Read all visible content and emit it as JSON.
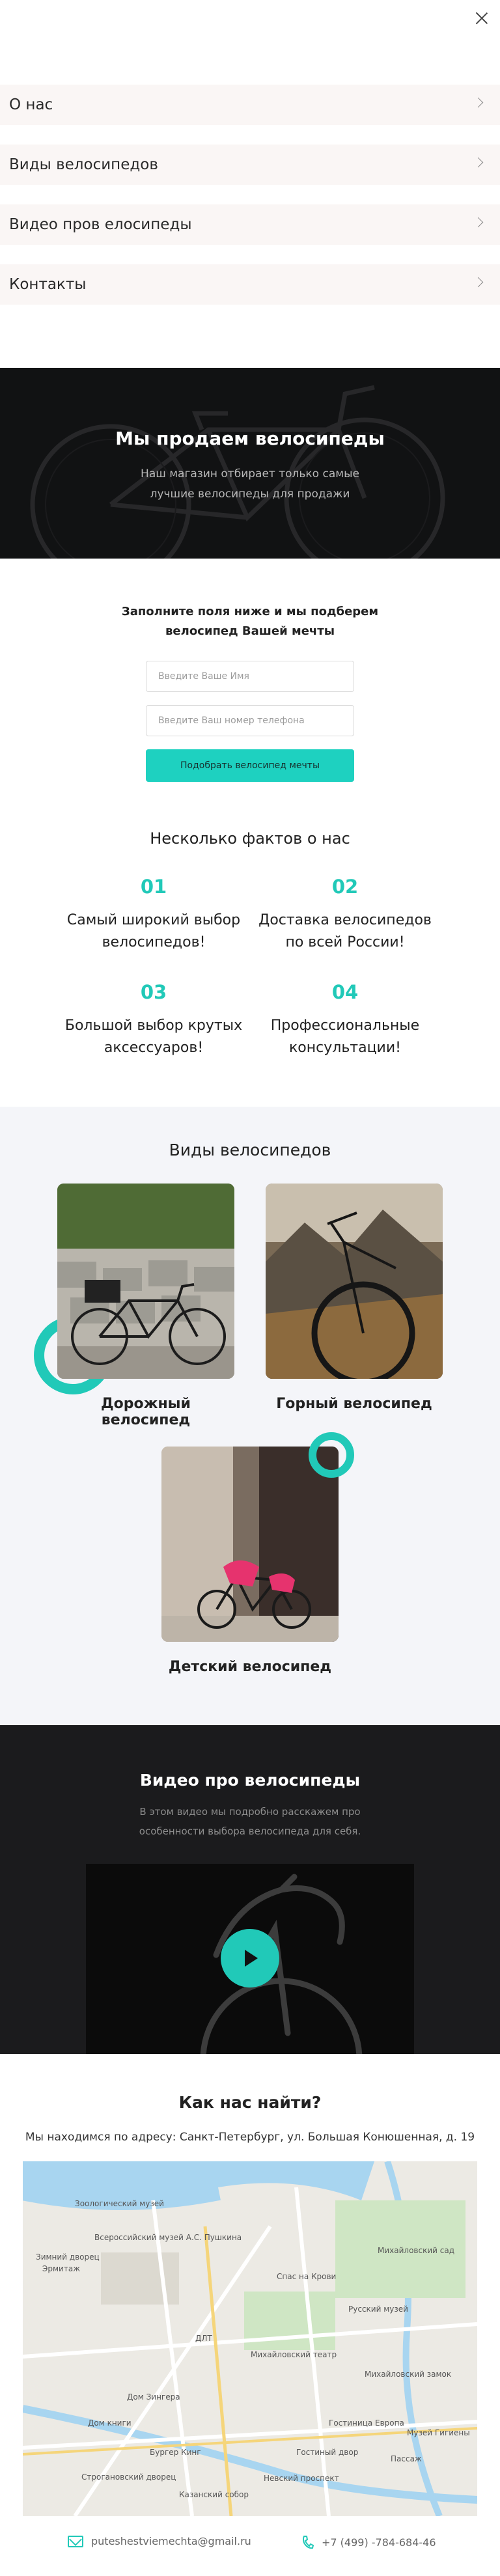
{
  "menu": {
    "items": [
      {
        "label": "О нас"
      },
      {
        "label": "Виды велосипедов"
      },
      {
        "label": "Видео пров елосипеды"
      },
      {
        "label": "Контакты"
      }
    ]
  },
  "hero": {
    "title": "Мы продаем велосипеды",
    "subtitle": "Наш магазин отбирает только самые лучшие велосипеды для продажи"
  },
  "form": {
    "title": "Заполните поля ниже и мы подберем велосипед Вашей мечты",
    "name_placeholder": "Введите Ваше Имя",
    "phone_placeholder": "Введите Ваш номер телефона",
    "submit_label": "Подобрать велосипед мечты"
  },
  "facts": {
    "title": "Несколько фактов о нас",
    "items": [
      {
        "num": "01",
        "text": "Самый широкий выбор велосипедов!"
      },
      {
        "num": "02",
        "text": "Доставка велосипедов по всей России!"
      },
      {
        "num": "03",
        "text": "Большой выбор крутых аксессуаров!"
      },
      {
        "num": "04",
        "text": "Профессиональные консультации!"
      }
    ]
  },
  "types": {
    "title": "Виды велосипедов",
    "cards": [
      {
        "label": "Дорожный велосипед"
      },
      {
        "label": "Горный велосипед"
      },
      {
        "label": "Детский велосипед"
      }
    ]
  },
  "video": {
    "title": "Видео про велосипеды",
    "subtitle": "В этом видео мы подробно расскажем про особенности выбора велосипеда для себя."
  },
  "find": {
    "title": "Как нас найти?",
    "address": "Мы находимся по адресу: Санкт-Петербург, ул. Большая Конюшенная, д. 19"
  },
  "map": {
    "labels": [
      "Зоологический музей",
      "Зимний дворец",
      "Эрмитаж",
      "Всероссийский музей А.С. Пушкина",
      "Спас на Крови",
      "Михайловский сад",
      "Русский музей",
      "Михайловский замок",
      "Михайловский театр",
      "Дом книги",
      "Казанский собор",
      "Строгановский дворец",
      "Невский проспект",
      "ДЛТ",
      "Гостиный двор",
      "Бургер Кинг",
      "Пассаж",
      "Музей Гигиены",
      "Гостиница Европа",
      "Дом Зингера"
    ]
  },
  "footer": {
    "email": "puteshestviemechta@gmail.ru",
    "phone": "+7 (499) -784-684-46"
  },
  "colors": {
    "accent": "#21c9b8",
    "menu_bg": "#faf6f5",
    "types_bg": "#f4f5f9",
    "dark_bg": "#1b1b1d"
  }
}
